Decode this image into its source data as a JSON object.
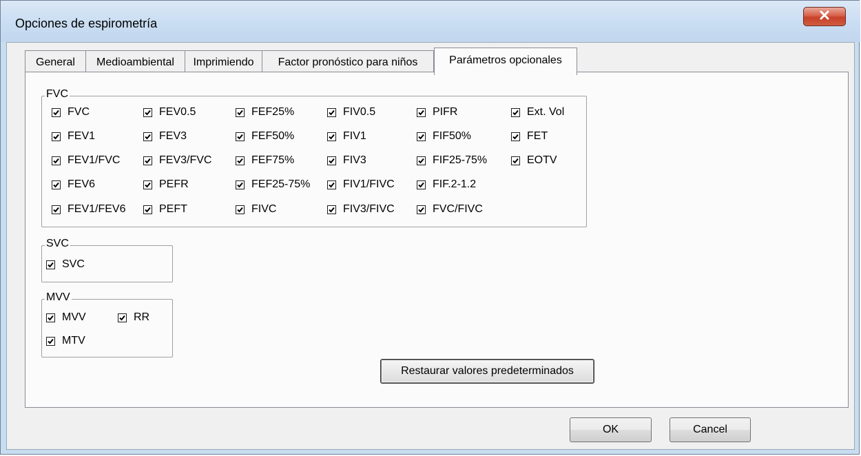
{
  "window": {
    "title": "Opciones de espirometría",
    "close_icon": "close-x-icon"
  },
  "tabs": [
    {
      "label": "General"
    },
    {
      "label": "Medioambiental"
    },
    {
      "label": "Imprimiendo"
    },
    {
      "label": "Factor pronóstico para niños"
    },
    {
      "label": "Parámetros opcionales",
      "active": true
    }
  ],
  "fvc_group": {
    "label": "FVC",
    "items": [
      {
        "label": "FVC",
        "checked": true
      },
      {
        "label": "FEV0.5",
        "checked": true
      },
      {
        "label": "FEF25%",
        "checked": true
      },
      {
        "label": "FIV0.5",
        "checked": true
      },
      {
        "label": "PIFR",
        "checked": true
      },
      {
        "label": "Ext. Vol",
        "checked": true
      },
      {
        "label": "FEV1",
        "checked": true
      },
      {
        "label": "FEV3",
        "checked": true
      },
      {
        "label": "FEF50%",
        "checked": true
      },
      {
        "label": "FIV1",
        "checked": true
      },
      {
        "label": "FIF50%",
        "checked": true
      },
      {
        "label": "FET",
        "checked": true
      },
      {
        "label": "FEV1/FVC",
        "checked": true
      },
      {
        "label": "FEV3/FVC",
        "checked": true
      },
      {
        "label": "FEF75%",
        "checked": true
      },
      {
        "label": "FIV3",
        "checked": true
      },
      {
        "label": "FIF25-75%",
        "checked": true
      },
      {
        "label": "EOTV",
        "checked": true
      },
      {
        "label": "FEV6",
        "checked": true
      },
      {
        "label": "PEFR",
        "checked": true
      },
      {
        "label": "FEF25-75%",
        "checked": true
      },
      {
        "label": "FIV1/FIVC",
        "checked": true
      },
      {
        "label": "FIF.2-1.2",
        "checked": true
      },
      {
        "label": "FEV1/FEV6",
        "checked": true
      },
      {
        "label": "PEFT",
        "checked": true
      },
      {
        "label": "FIVC",
        "checked": true
      },
      {
        "label": "FIV3/FIVC",
        "checked": true
      },
      {
        "label": "FVC/FIVC",
        "checked": true
      }
    ]
  },
  "svc_group": {
    "label": "SVC",
    "items": [
      {
        "label": "SVC",
        "checked": true
      }
    ]
  },
  "mvv_group": {
    "label": "MVV",
    "items": [
      {
        "label": "MVV",
        "checked": true
      },
      {
        "label": "RR",
        "checked": true
      },
      {
        "label": "MTV",
        "checked": true
      }
    ]
  },
  "buttons": {
    "restore": "Restaurar valores predeterminados",
    "ok": "OK",
    "cancel": "Cancel"
  }
}
